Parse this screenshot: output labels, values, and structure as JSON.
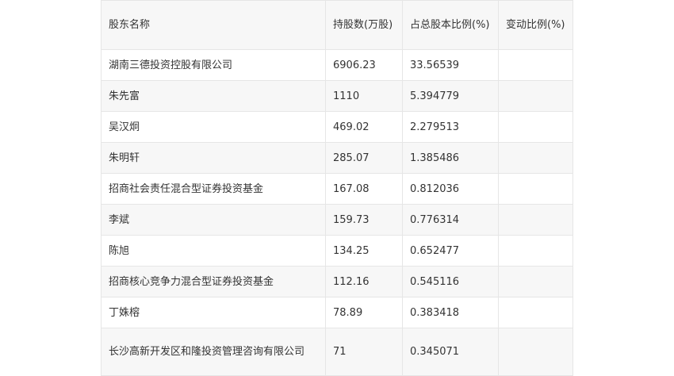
{
  "table": {
    "headers": [
      "股东名称",
      "持股数(万股)",
      "占总股本比例(%)",
      "变动比例(%)"
    ],
    "rows": [
      [
        "湖南三德投资控股有限公司",
        "6906.23",
        "33.56539",
        ""
      ],
      [
        "朱先富",
        "1110",
        "5.394779",
        ""
      ],
      [
        "吴汉炯",
        "469.02",
        "2.279513",
        ""
      ],
      [
        "朱明轩",
        "285.07",
        "1.385486",
        ""
      ],
      [
        "招商社会责任混合型证券投资基金",
        "167.08",
        "0.812036",
        ""
      ],
      [
        "李斌",
        "159.73",
        "0.776314",
        ""
      ],
      [
        "陈旭",
        "134.25",
        "0.652477",
        ""
      ],
      [
        "招商核心竞争力混合型证券投资基金",
        "112.16",
        "0.545116",
        ""
      ],
      [
        "丁姝榕",
        "78.89",
        "0.383418",
        ""
      ],
      [
        "长沙高新开发区和隆投资管理咨询有限公司",
        "71",
        "0.345071",
        ""
      ]
    ]
  }
}
